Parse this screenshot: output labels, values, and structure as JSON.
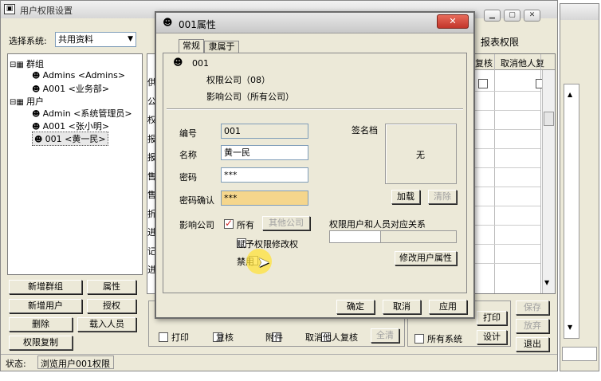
{
  "main": {
    "title": "用户权限设置",
    "system_label": "选择系统:",
    "system_value": "共用资料",
    "tree": [
      {
        "text": "群组",
        "level": 0,
        "expand": "⊟"
      },
      {
        "text": "Admins <Admins>",
        "level": 1
      },
      {
        "text": "A001 <业务部>",
        "level": 1
      },
      {
        "text": "用户",
        "level": 0,
        "expand": "⊟"
      },
      {
        "text": "Admin <系统管理员>",
        "level": 1
      },
      {
        "text": "A001 <张小明>",
        "level": 1
      },
      {
        "text": "001 <黄一民>",
        "level": 1
      }
    ],
    "left_buttons": [
      "新增群组",
      "属性",
      "新增用户",
      "授权",
      "删除",
      "载入人员",
      "权限复制"
    ],
    "grid_side_chars": [
      "供",
      "公",
      "权",
      "报",
      "报",
      "售",
      "售",
      "折",
      "进",
      "记",
      "进"
    ],
    "right_header": "报表权限",
    "col_header_1": "复核",
    "col_header_2": "取消他人复",
    "bottom_checks": [
      "打印",
      "复核",
      "附件",
      "取消他人复核"
    ],
    "all_button": "全清",
    "print_button": "打印",
    "all_sys_label": "所有系统",
    "design_button": "设计",
    "save_button": "保存",
    "discard_button": "放弃",
    "exit_button": "退出",
    "status_label": "状态:",
    "status_text": "浏览用户001权限"
  },
  "dialog": {
    "title": "001属性",
    "tabs": [
      "常规",
      "隶属于"
    ],
    "user_id": "001",
    "perm_company": "权限公司（08）",
    "effect_company": "影响公司（所有公司）",
    "id_label": "编号",
    "id_value": "001",
    "name_label": "名称",
    "name_value": "黄一民",
    "pwd_label": "密码",
    "pwd_value": "***",
    "pwd_confirm_label": "密码确认",
    "pwd_confirm_value": "***",
    "signature_label": "签名档",
    "signature_text": "无",
    "load_button": "加载",
    "clear_button": "清除",
    "effect_label": "影响公司",
    "all_label": "所有",
    "all_checked": true,
    "other_company_button": "其他公司",
    "grant_label": "赋予权限修改权",
    "disable_label": "禁用",
    "relation_label": "权限用户和人员对应关系",
    "modify_button": "修改用户属性",
    "ok_button": "确定",
    "cancel_button": "取消",
    "apply_button": "应用"
  }
}
